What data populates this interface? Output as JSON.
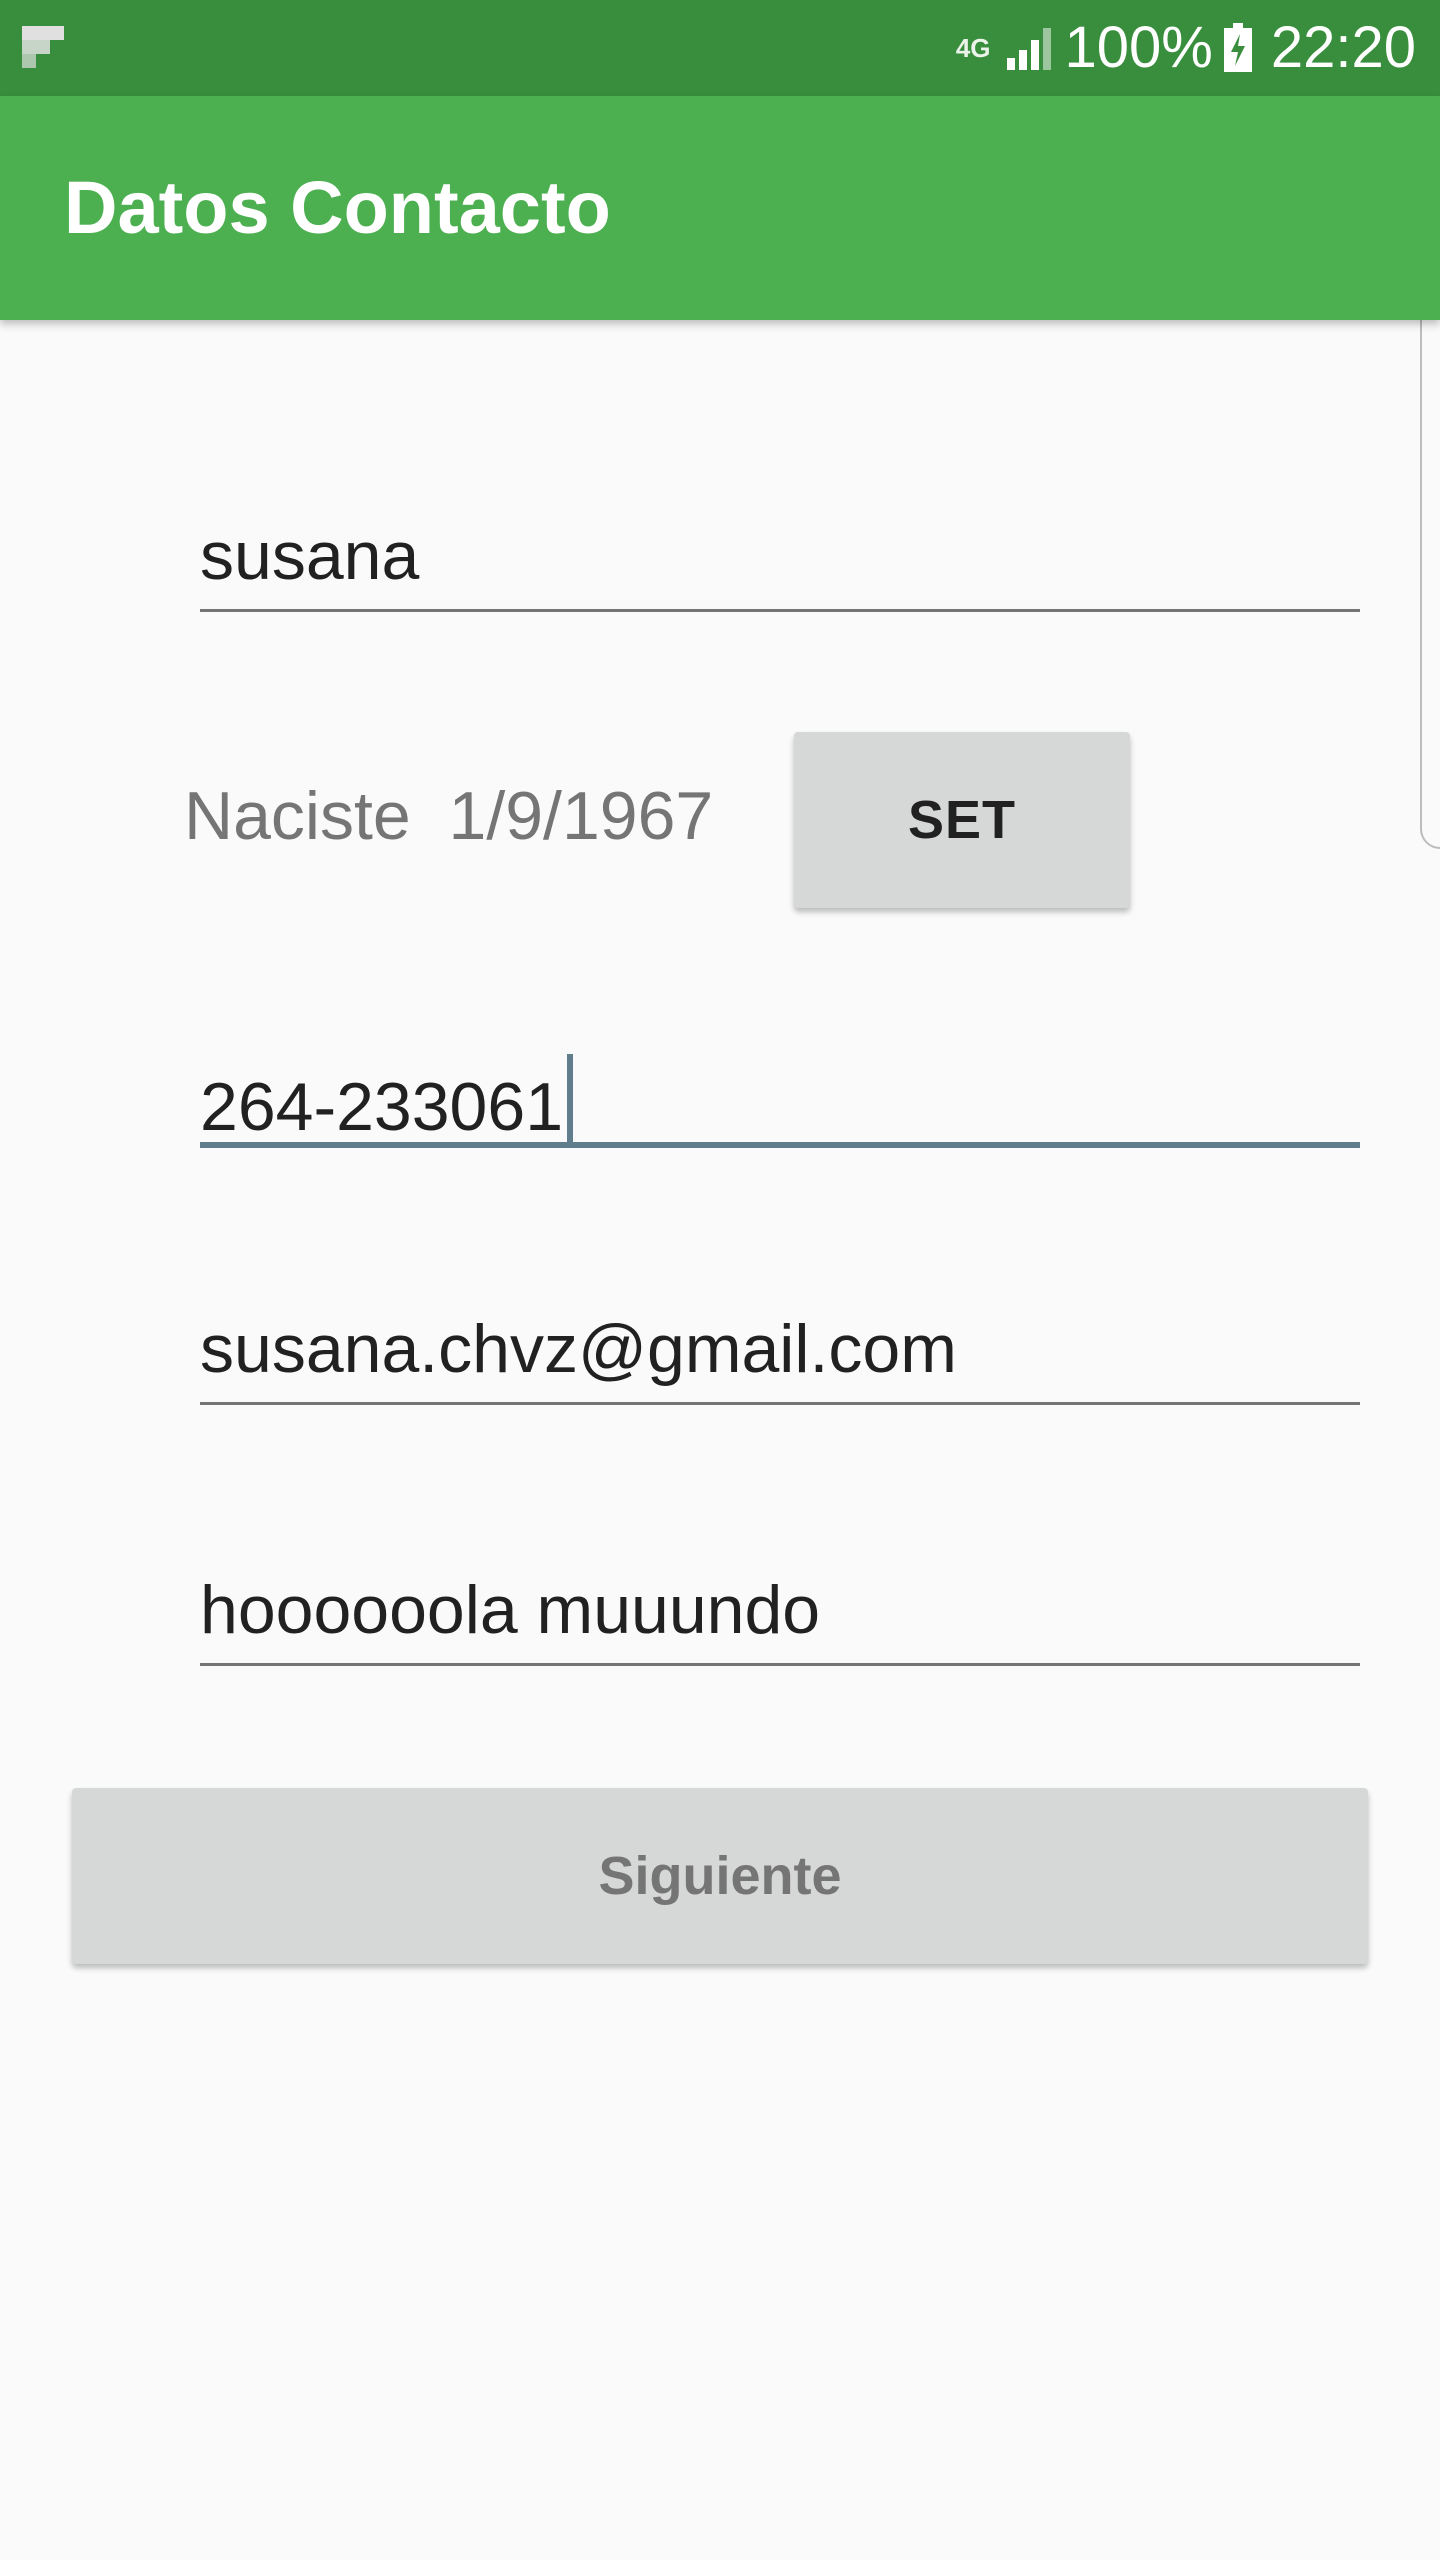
{
  "status_bar": {
    "left_icon": "flipboard-icon",
    "network_type": "4G",
    "signal_icon": "signal-bars-icon",
    "battery_percent": "100%",
    "battery_icon": "battery-charging-icon",
    "time": "22:20"
  },
  "app_bar": {
    "title": "Datos Contacto"
  },
  "form": {
    "name_value": "susana",
    "dob_label": "Naciste  1/9/1967",
    "set_button_label": "SET",
    "phone_value": "264-233061",
    "email_value": "susana.chvz@gmail.com",
    "description_value": "hoooooola muuundo",
    "next_button_label": "Siguiente"
  },
  "colors": {
    "status_bar": "#388e3c",
    "app_bar": "#4caf50",
    "background": "#fafafa",
    "button": "#d6d7d7",
    "focused_underline": "#607d8b"
  }
}
